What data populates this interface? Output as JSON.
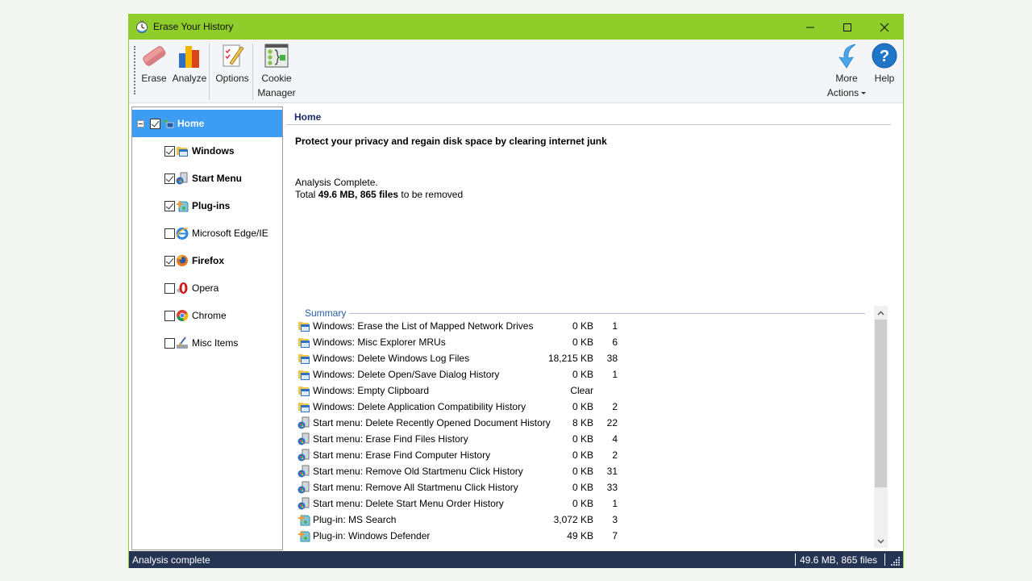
{
  "window": {
    "title": "Erase Your History",
    "controls": {
      "minimize": "minimize",
      "maximize": "maximize",
      "close": "close"
    }
  },
  "toolbar": {
    "erase": "Erase",
    "analyze": "Analyze",
    "options": "Options",
    "cookie_manager_line1": "Cookie",
    "cookie_manager_line2": "Manager",
    "more_actions_line1": "More",
    "more_actions_line2": "Actions",
    "help": "Help"
  },
  "tree": {
    "root": {
      "label": "Home",
      "checked": true,
      "expanded": true,
      "selected": true,
      "icon": "home-globe-icon"
    },
    "items": [
      {
        "label": "Windows",
        "checked": true,
        "bold": true,
        "icon": "windows-folder-icon"
      },
      {
        "label": "Start Menu",
        "checked": true,
        "bold": true,
        "icon": "start-menu-icon"
      },
      {
        "label": "Plug-ins",
        "checked": true,
        "bold": true,
        "icon": "plugin-icon"
      },
      {
        "label": "Microsoft Edge/IE",
        "checked": false,
        "bold": false,
        "icon": "ie-icon"
      },
      {
        "label": "Firefox",
        "checked": true,
        "bold": true,
        "icon": "firefox-icon"
      },
      {
        "label": "Opera",
        "checked": false,
        "bold": false,
        "icon": "opera-icon"
      },
      {
        "label": "Chrome",
        "checked": false,
        "bold": false,
        "icon": "chrome-icon"
      },
      {
        "label": "Misc Items",
        "checked": false,
        "bold": false,
        "icon": "misc-broom-icon"
      }
    ]
  },
  "content": {
    "title": "Home",
    "headline": "Protect your privacy and regain disk space by clearing internet junk",
    "status_line1": "Analysis Complete.",
    "status_line2_prefix": "Total ",
    "status_line2_bold": "49.6 MB, 865 files",
    "status_line2_suffix": " to be removed",
    "summary_label": "Summary",
    "summary_rows": [
      {
        "icon": "windows",
        "label": "Windows: Erase the List of Mapped Network Drives",
        "size": "0 KB",
        "count": "1"
      },
      {
        "icon": "windows",
        "label": "Windows: Misc Explorer MRUs",
        "size": "0 KB",
        "count": "6"
      },
      {
        "icon": "windows",
        "label": "Windows: Delete Windows Log Files",
        "size": "18,215 KB",
        "count": "38"
      },
      {
        "icon": "windows",
        "label": "Windows: Delete Open/Save Dialog History",
        "size": "0 KB",
        "count": "1"
      },
      {
        "icon": "windows",
        "label": "Windows: Empty Clipboard",
        "size": "Clear",
        "count": ""
      },
      {
        "icon": "windows",
        "label": "Windows: Delete Application Compatibility History",
        "size": "0 KB",
        "count": "2"
      },
      {
        "icon": "startmenu",
        "label": "Start menu: Delete Recently Opened Document History",
        "size": "8 KB",
        "count": "22"
      },
      {
        "icon": "startmenu",
        "label": "Start menu: Erase Find Files History",
        "size": "0 KB",
        "count": "4"
      },
      {
        "icon": "startmenu",
        "label": "Start menu: Erase Find Computer History",
        "size": "0 KB",
        "count": "2"
      },
      {
        "icon": "startmenu",
        "label": "Start menu: Remove Old Startmenu Click History",
        "size": "0 KB",
        "count": "31"
      },
      {
        "icon": "startmenu",
        "label": "Start menu: Remove All Startmenu Click History",
        "size": "0 KB",
        "count": "33"
      },
      {
        "icon": "startmenu",
        "label": "Start menu: Delete Start Menu Order History",
        "size": "0 KB",
        "count": "1"
      },
      {
        "icon": "plugin",
        "label": "Plug-in: MS Search",
        "size": "3,072 KB",
        "count": "3"
      },
      {
        "icon": "plugin",
        "label": "Plug-in: Windows Defender",
        "size": "49 KB",
        "count": "7"
      }
    ]
  },
  "statusbar": {
    "left": "Analysis complete",
    "right": "49.6 MB, 865 files"
  },
  "colors": {
    "titlebar": "#8fcd2b",
    "selection": "#3c9df2",
    "statusbar": "#263453",
    "content_title": "#1b2b6b",
    "summary_label": "#2b5ca8"
  }
}
